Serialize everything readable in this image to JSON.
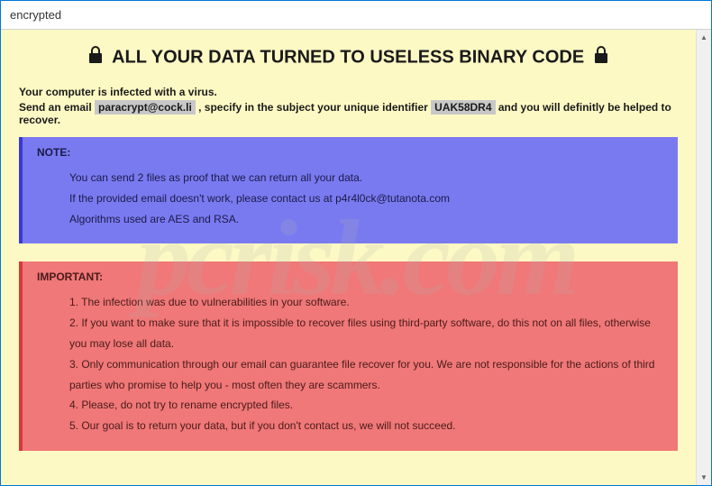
{
  "window": {
    "title": "encrypted"
  },
  "header": {
    "title": "ALL YOUR DATA TURNED TO USELESS BINARY CODE"
  },
  "intro": {
    "line1": "Your computer is infected with a virus.",
    "line2_pre": "Send an email ",
    "email": "paracrypt@cock.li",
    "line2_mid": " , specify in the subject your unique identifier ",
    "identifier": "UAK58DR4",
    "line2_post": " and you will definitly be helped to recover."
  },
  "note": {
    "title": "NOTE:",
    "line1": "You can send 2 files as proof that we can return all your data.",
    "line2": "If the provided email doesn't work, please contact us at p4r4l0ck@tutanota.com",
    "line3": "Algorithms used are AES and RSA."
  },
  "important": {
    "title": "IMPORTANT:",
    "item1": "1. The infection was due to vulnerabilities in your software.",
    "item2": "2. If you want to make sure that it is impossible to recover files using third-party software, do this not on all files, otherwise you may lose all data.",
    "item3": "3. Only communication through our email can guarantee file recover for you. We are not responsible for the actions of third parties who promise to help you - most often they are scammers.",
    "item4": "4. Please, do not try to rename encrypted files.",
    "item5": "5. Our goal is to return your data, but if you don't contact us, we will not succeed."
  },
  "watermark": "pcrisk.com"
}
